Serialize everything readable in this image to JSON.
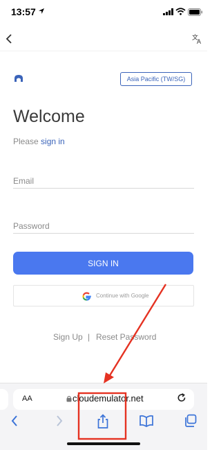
{
  "status_bar": {
    "time": "13:57",
    "icons": [
      "location-arrow-icon",
      "signal-bars-icon",
      "wifi-icon",
      "battery-icon"
    ]
  },
  "top_nav": {
    "back_icon": "chevron-left-icon",
    "translate_icon": "translate-icon"
  },
  "login": {
    "logo_icon": "cloud-logo-icon",
    "region_label": "Asia Pacific (TW/SG)",
    "title": "Welcome",
    "subtitle_prefix": "Please",
    "subtitle_link": "sign in",
    "email_placeholder": "Email",
    "password_placeholder": "Password",
    "signin_label": "SIGN IN",
    "google_label": "Continue with Google",
    "signup_label": "Sign Up",
    "separator": "|",
    "reset_label": "Reset Password"
  },
  "browser": {
    "text_size_label": "AA",
    "url": "cloudemulator.net",
    "toolbar_icons": [
      "back-arrow-icon",
      "forward-arrow-icon",
      "share-icon",
      "bookmarks-icon",
      "tabs-icon"
    ]
  },
  "colors": {
    "accent": "#4a78ef",
    "link": "#3a63b9",
    "annotation": "#e53222"
  }
}
